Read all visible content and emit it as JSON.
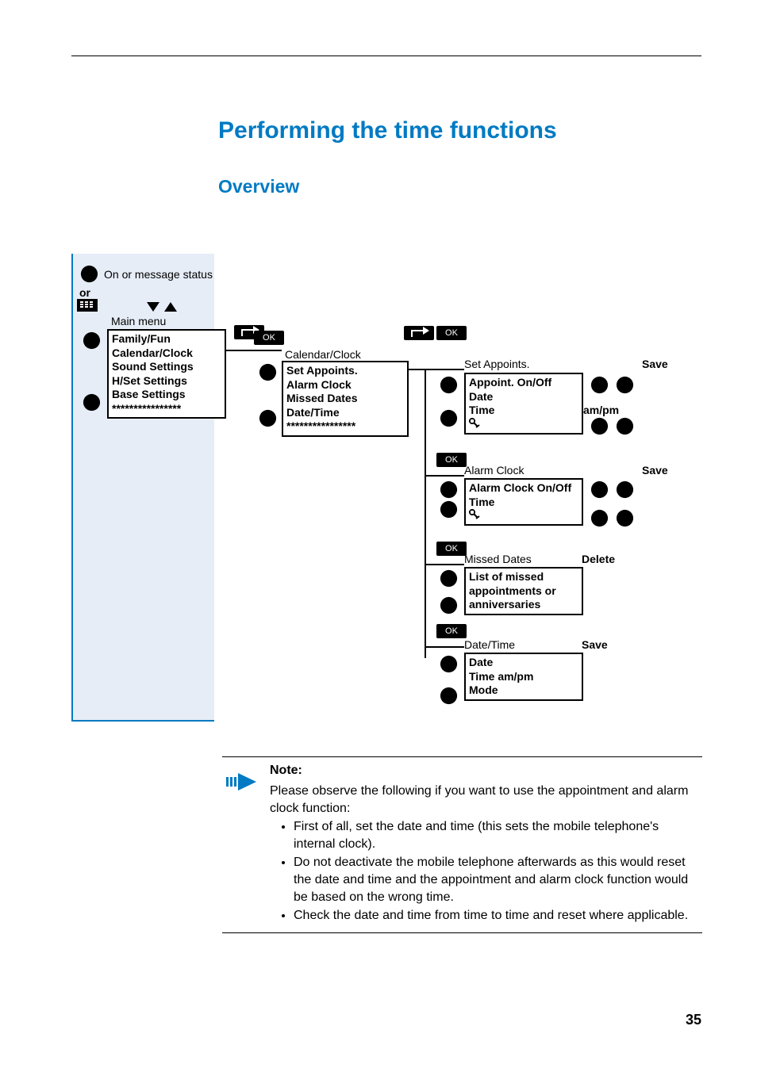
{
  "heading1": "Performing the time functions",
  "heading2": "Overview",
  "status_line": "On or message status",
  "or_label": "or",
  "main_menu_label": "Main menu",
  "main_menu": {
    "items": [
      "Family/Fun",
      "Calendar/Clock",
      "Sound Settings",
      "H/Set Settings",
      "Base Settings",
      "****************"
    ]
  },
  "sub1_title": "Calendar/Clock",
  "sub1": {
    "items": [
      "Set Appoints.",
      "Alarm Clock",
      "Missed Dates",
      "Date/Time",
      "****************"
    ]
  },
  "ok_label": "OK",
  "set_appoints": {
    "title": "Set Appoints.",
    "soft": "Save",
    "rows": [
      "Appoint. On/Off",
      "Date",
      "Time"
    ],
    "ampm": "am/pm"
  },
  "alarm": {
    "title": "Alarm Clock",
    "soft": "Save",
    "rows": [
      "Alarm Clock On/Off",
      "Time"
    ]
  },
  "missed": {
    "title": "Missed Dates",
    "soft": "Delete",
    "text": "List of missed appointments or anniversaries"
  },
  "datetime": {
    "title": "Date/Time",
    "soft": "Save",
    "rows": [
      "Date",
      "Time am/pm",
      "Mode"
    ]
  },
  "note": {
    "label": "Note:",
    "intro": "Please observe the following if you want to use the appointment and alarm clock function:",
    "bullets": [
      "First of all, set the date and time (this sets the mobile telephone's internal clock).",
      "Do not deactivate the mobile telephone afterwards as this would reset the date and time and the appointment and alarm clock function would be based on the wrong time.",
      "Check the date and time from time to time and reset where applicable."
    ]
  },
  "page_number": "35"
}
